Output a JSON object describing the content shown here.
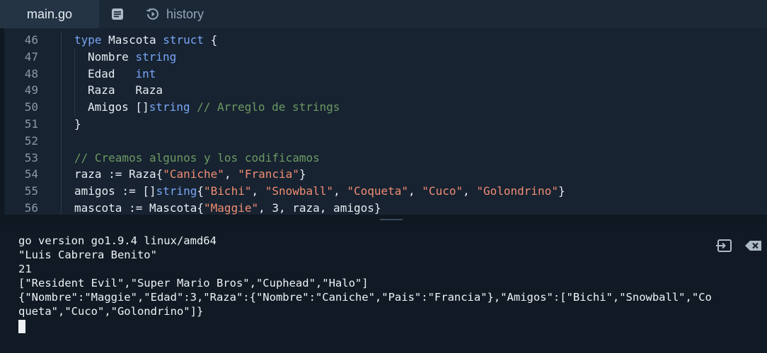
{
  "tabs": {
    "main": "main.go",
    "history": "history"
  },
  "editor": {
    "lines": [
      {
        "n": "46",
        "indent": 0,
        "parts": [
          [
            "kw",
            "type"
          ],
          [
            "t",
            " Mascota "
          ],
          [
            "kw",
            "struct"
          ],
          [
            "t",
            " {"
          ]
        ]
      },
      {
        "n": "47",
        "indent": 1,
        "parts": [
          [
            "t",
            "Nombre "
          ],
          [
            "kw",
            "string"
          ]
        ]
      },
      {
        "n": "48",
        "indent": 1,
        "parts": [
          [
            "t",
            "Edad   "
          ],
          [
            "kw",
            "int"
          ]
        ]
      },
      {
        "n": "49",
        "indent": 1,
        "parts": [
          [
            "t",
            "Raza   Raza"
          ]
        ]
      },
      {
        "n": "50",
        "indent": 1,
        "parts": [
          [
            "t",
            "Amigos []"
          ],
          [
            "kw",
            "string"
          ],
          [
            "t",
            " "
          ],
          [
            "com",
            "// Arreglo de strings"
          ]
        ]
      },
      {
        "n": "51",
        "indent": 0,
        "parts": [
          [
            "t",
            "}"
          ]
        ]
      },
      {
        "n": "52",
        "indent": 0,
        "parts": []
      },
      {
        "n": "53",
        "indent": 0,
        "parts": [
          [
            "com",
            "// Creamos algunos y los codificamos"
          ]
        ]
      },
      {
        "n": "54",
        "indent": 0,
        "parts": [
          [
            "t",
            "raza := Raza{"
          ],
          [
            "str",
            "\"Caniche\""
          ],
          [
            "t",
            ", "
          ],
          [
            "str",
            "\"Francia\""
          ],
          [
            "t",
            "}"
          ]
        ]
      },
      {
        "n": "55",
        "indent": 0,
        "parts": [
          [
            "t",
            "amigos := []"
          ],
          [
            "kw",
            "string"
          ],
          [
            "t",
            "{"
          ],
          [
            "str",
            "\"Bichi\""
          ],
          [
            "t",
            ", "
          ],
          [
            "str",
            "\"Snowball\""
          ],
          [
            "t",
            ", "
          ],
          [
            "str",
            "\"Coqueta\""
          ],
          [
            "t",
            ", "
          ],
          [
            "str",
            "\"Cuco\""
          ],
          [
            "t",
            ", "
          ],
          [
            "str",
            "\"Golondrino\""
          ],
          [
            "t",
            "}"
          ]
        ]
      },
      {
        "n": "56",
        "indent": 0,
        "parts": [
          [
            "t",
            "mascota := Mascota{"
          ],
          [
            "str",
            "\"Maggie\""
          ],
          [
            "t",
            ", 3, raza, amigos}"
          ]
        ]
      }
    ]
  },
  "console": {
    "output": [
      "go version go1.9.4 linux/amd64",
      "\"Luis Cabrera Benito\"",
      "21",
      "[\"Resident Evil\",\"Super Mario Bros\",\"Cuphead\",\"Halo\"]",
      "{\"Nombre\":\"Maggie\",\"Edad\":3,\"Raza\":{\"Nombre\":\"Caniche\",\"Pais\":\"Francia\"},\"Amigos\":[\"Bichi\",\"Snowball\",\"Co",
      "queta\",\"Cuco\",\"Golondrino\"]}"
    ]
  },
  "icons": {
    "notes": "notes-icon",
    "history": "history-icon",
    "run-input": "console-input-icon",
    "clear": "clear-console-icon"
  },
  "colors": {
    "keyword": "#79a6f6",
    "string": "#f08d72",
    "comment": "#6c9a62",
    "editor_bg": "#172331",
    "console_bg": "#111a24"
  }
}
